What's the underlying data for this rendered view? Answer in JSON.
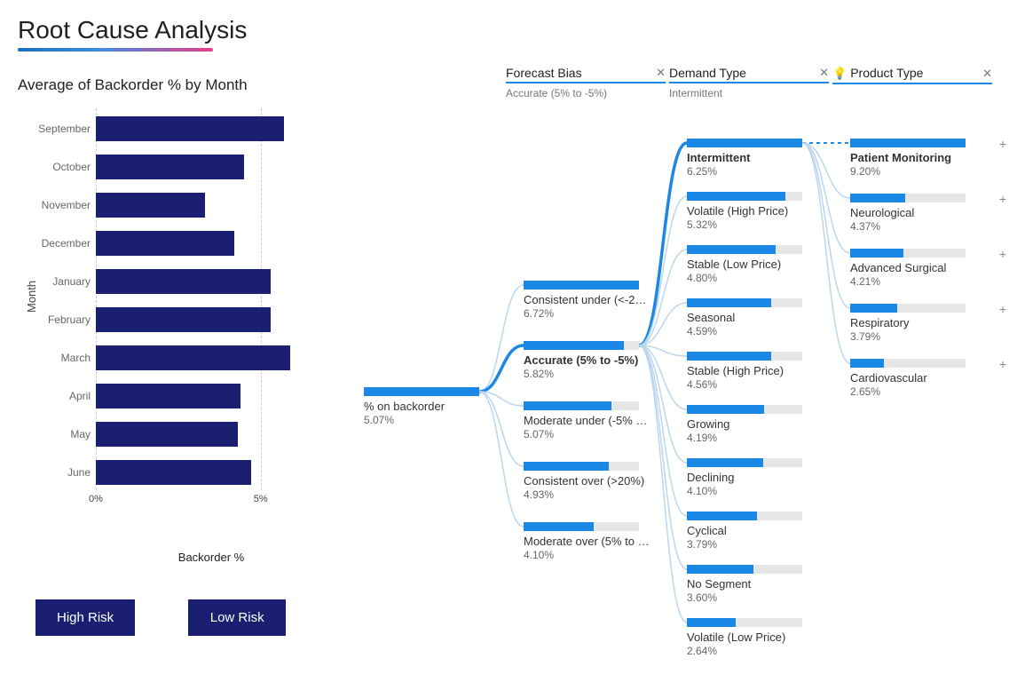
{
  "title": "Root Cause Analysis",
  "left": {
    "chart_title": "Average of Backorder % by Month",
    "y_axis_label": "Month",
    "x_axis_label": "Backorder %",
    "x_ticks": [
      "0%",
      "5%"
    ],
    "buttons": {
      "high": "High Risk",
      "low": "Low Risk"
    }
  },
  "chart_data": {
    "type": "bar",
    "orientation": "horizontal",
    "title": "Average of Backorder % by Month",
    "xlabel": "Backorder %",
    "ylabel": "Month",
    "xlim": [
      0,
      7
    ],
    "categories": [
      "September",
      "October",
      "November",
      "December",
      "January",
      "February",
      "March",
      "April",
      "May",
      "June"
    ],
    "values": [
      5.7,
      4.5,
      3.3,
      4.2,
      5.3,
      5.3,
      5.9,
      4.4,
      4.3,
      4.7
    ]
  },
  "tree": {
    "headers": [
      {
        "title": "Forecast Bias",
        "sub": "Accurate (5% to -5%)"
      },
      {
        "title": "Demand Type",
        "sub": "Intermittent"
      },
      {
        "title": "Product Type",
        "sub": ""
      }
    ],
    "root": {
      "label": "% on backorder",
      "value": "5.07%",
      "fill": 100
    },
    "level1": [
      {
        "label": "Consistent under (<-2…",
        "value": "6.72%",
        "fill": 100
      },
      {
        "label": "Accurate (5% to -5%)",
        "value": "5.82%",
        "fill": 87,
        "bold": true
      },
      {
        "label": "Moderate under (-5% …",
        "value": "5.07%",
        "fill": 76
      },
      {
        "label": "Consistent over (>20%)",
        "value": "4.93%",
        "fill": 74
      },
      {
        "label": "Moderate over (5% to …",
        "value": "4.10%",
        "fill": 61
      }
    ],
    "level2": [
      {
        "label": "Intermittent",
        "value": "6.25%",
        "fill": 100,
        "bold": true
      },
      {
        "label": "Volatile (High Price)",
        "value": "5.32%",
        "fill": 85
      },
      {
        "label": "Stable (Low Price)",
        "value": "4.80%",
        "fill": 77
      },
      {
        "label": "Seasonal",
        "value": "4.59%",
        "fill": 73
      },
      {
        "label": "Stable (High Price)",
        "value": "4.56%",
        "fill": 73
      },
      {
        "label": "Growing",
        "value": "4.19%",
        "fill": 67
      },
      {
        "label": "Declining",
        "value": "4.10%",
        "fill": 66
      },
      {
        "label": "Cyclical",
        "value": "3.79%",
        "fill": 61
      },
      {
        "label": "No Segment",
        "value": "3.60%",
        "fill": 58
      },
      {
        "label": "Volatile (Low Price)",
        "value": "2.64%",
        "fill": 42
      }
    ],
    "level3": [
      {
        "label": "Patient Monitoring",
        "value": "9.20%",
        "fill": 100,
        "bold": true,
        "plus": true
      },
      {
        "label": "Neurological",
        "value": "4.37%",
        "fill": 48,
        "plus": true
      },
      {
        "label": "Advanced Surgical",
        "value": "4.21%",
        "fill": 46,
        "plus": true
      },
      {
        "label": "Respiratory",
        "value": "3.79%",
        "fill": 41,
        "plus": true
      },
      {
        "label": "Cardiovascular",
        "value": "2.65%",
        "fill": 29,
        "plus": true
      }
    ]
  }
}
